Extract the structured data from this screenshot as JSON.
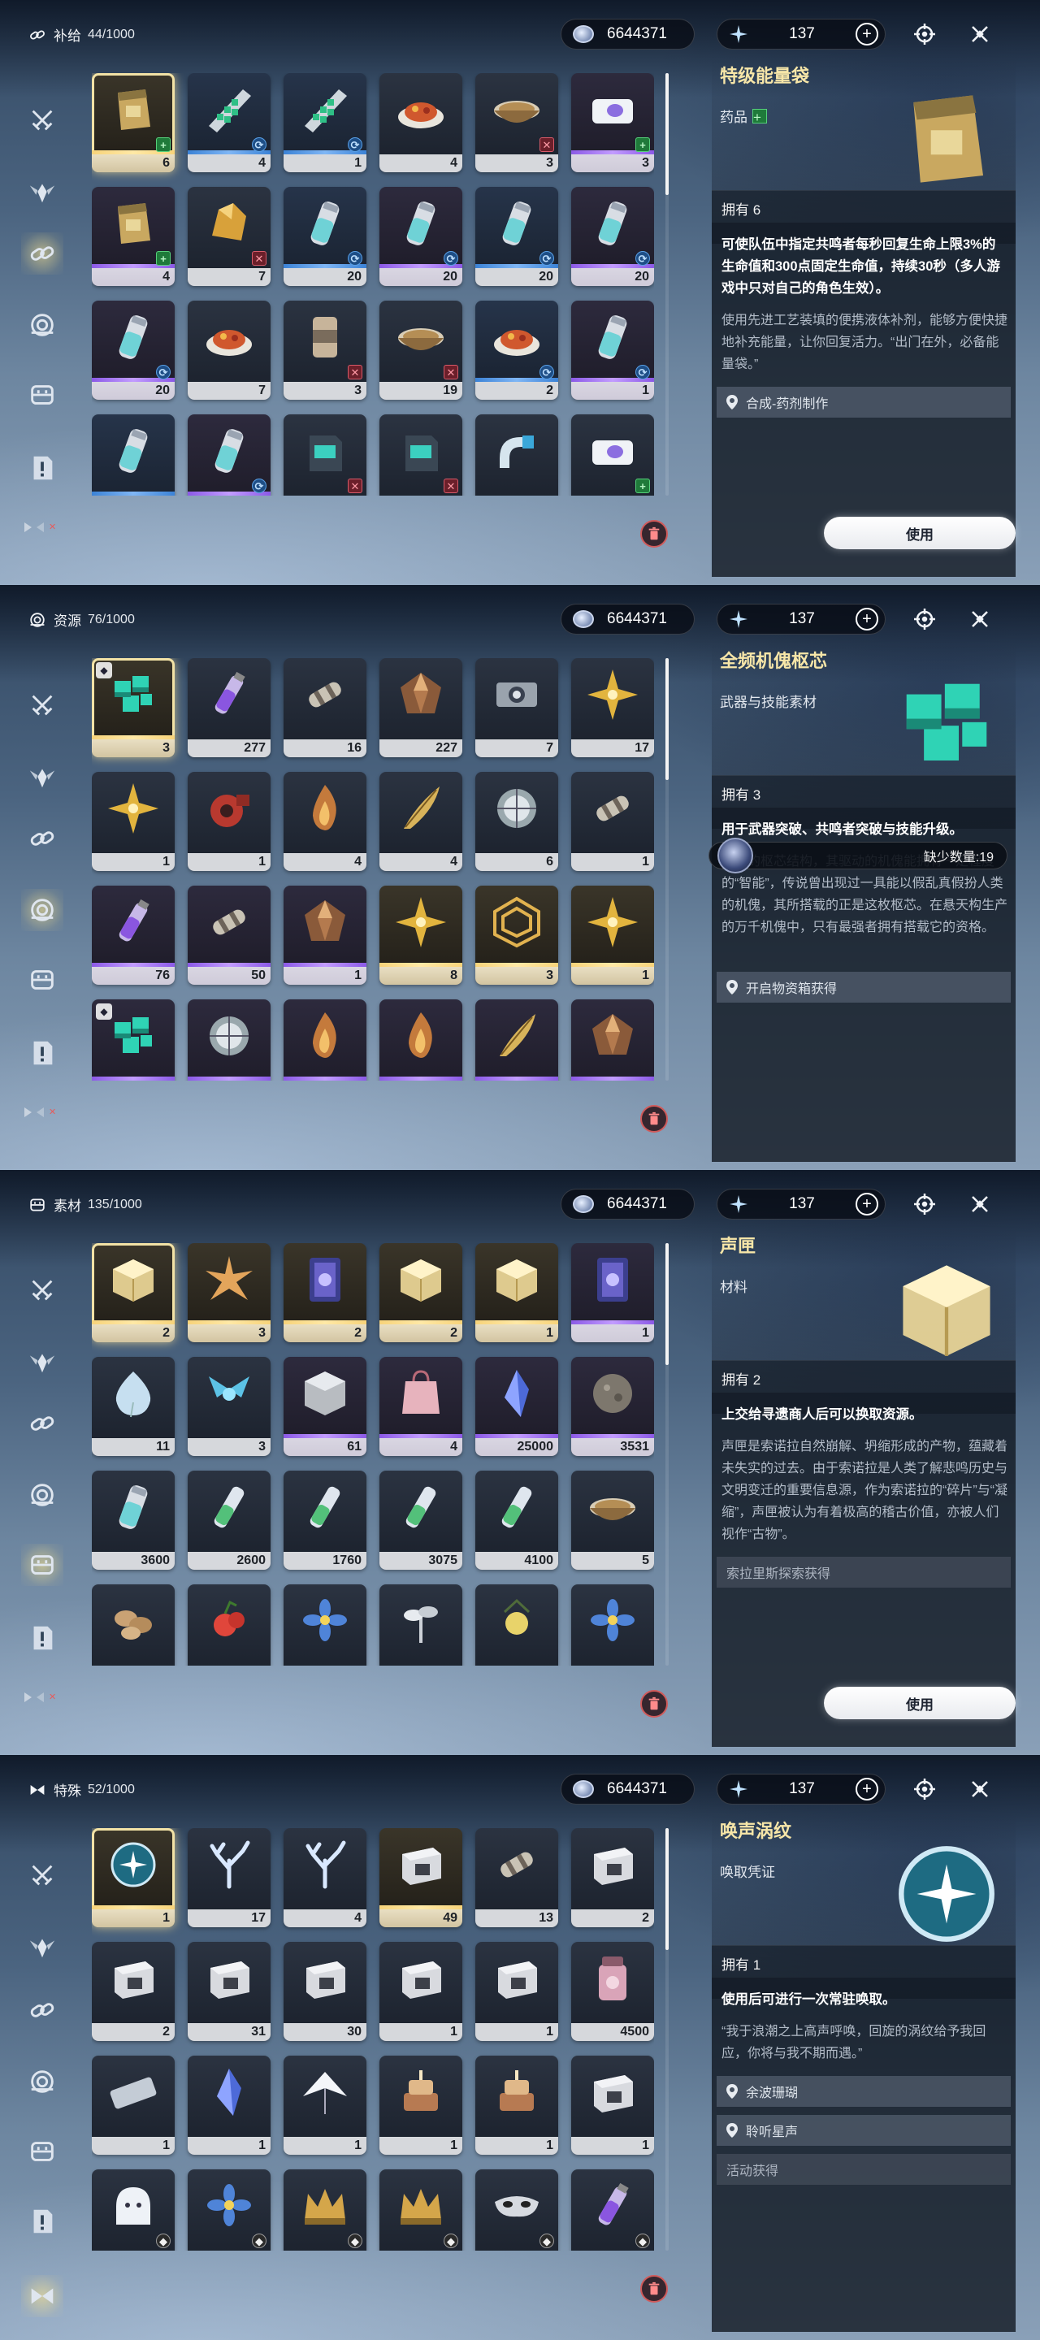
{
  "currency": {
    "shell_credit": "6644371",
    "astrite": "137"
  },
  "panels": [
    {
      "category": "补给",
      "count": "44/1000",
      "active_nav": 2,
      "selected": 0,
      "items": [
        {
          "qty": "6",
          "q": "gold",
          "badge": "plus",
          "icon": "pouch-icon"
        },
        {
          "qty": "4",
          "q": "blue",
          "badge": "swap",
          "icon": "tile-crystal-icon"
        },
        {
          "qty": "1",
          "q": "blue",
          "badge": "swap",
          "icon": "tile-crystal-icon"
        },
        {
          "qty": "4",
          "q": "gray",
          "badge": "",
          "icon": "dish-icon"
        },
        {
          "qty": "3",
          "q": "gray",
          "badge": "cross",
          "icon": "bowl-icon"
        },
        {
          "qty": "3",
          "q": "purple",
          "badge": "plus",
          "icon": "pack-icon"
        },
        {
          "qty": "4",
          "q": "purple",
          "badge": "plus",
          "icon": "pouch-icon"
        },
        {
          "qty": "7",
          "q": "gray",
          "badge": "cross",
          "icon": "ore-icon"
        },
        {
          "qty": "20",
          "q": "blue",
          "badge": "swap",
          "icon": "canister-icon"
        },
        {
          "qty": "20",
          "q": "purple",
          "badge": "swap",
          "icon": "canister-icon"
        },
        {
          "qty": "20",
          "q": "blue",
          "badge": "swap",
          "icon": "canister-icon"
        },
        {
          "qty": "20",
          "q": "purple",
          "badge": "swap",
          "icon": "canister-icon"
        },
        {
          "qty": "20",
          "q": "purple",
          "badge": "swap",
          "icon": "canister-icon"
        },
        {
          "qty": "7",
          "q": "gray",
          "badge": "",
          "icon": "dish-icon"
        },
        {
          "qty": "3",
          "q": "gray",
          "badge": "cross",
          "icon": "can-icon"
        },
        {
          "qty": "19",
          "q": "gray",
          "badge": "cross",
          "icon": "bowl-icon"
        },
        {
          "qty": "2",
          "q": "blue",
          "badge": "swap",
          "icon": "dish-icon"
        },
        {
          "qty": "1",
          "q": "purple",
          "badge": "swap",
          "icon": "canister-icon"
        },
        {
          "qty": "",
          "q": "blue",
          "badge": "",
          "icon": "canister-icon"
        },
        {
          "qty": "",
          "q": "purple",
          "badge": "swap",
          "icon": "canister-icon"
        },
        {
          "qty": "",
          "q": "gray",
          "badge": "cross",
          "icon": "jerrycan-icon"
        },
        {
          "qty": "",
          "q": "gray",
          "badge": "cross",
          "icon": "jerrycan-icon"
        },
        {
          "qty": "",
          "q": "gray",
          "badge": "",
          "icon": "tube-icon"
        },
        {
          "qty": "",
          "q": "gray",
          "badge": "plus",
          "icon": "pack-icon"
        }
      ],
      "detail": {
        "name": "特级能量袋",
        "type": "药品",
        "type_badge": "plus",
        "icon": "pouch-icon",
        "owned": "拥有 6",
        "effect": "可使队伍中指定共鸣者每秒回复生命上限3%的生命值和300点固定生命值，持续30秒（多人游戏中只对自己的角色生效）。",
        "desc": "使用先进工艺装填的便携液体补剂，能够方便快捷地补充能量，让你回复活力。“出门在外，必备能量袋。”",
        "sources": [
          {
            "text": "合成-药剂制作",
            "pin": true
          }
        ],
        "use_label": "使用",
        "lack": ""
      }
    },
    {
      "category": "资源",
      "count": "76/1000",
      "active_nav": 3,
      "selected": 0,
      "items": [
        {
          "qty": "3",
          "q": "gold",
          "badge": "",
          "icon": "cube-icon",
          "mark": true
        },
        {
          "qty": "277",
          "q": "gray",
          "badge": "",
          "icon": "bottle-icon"
        },
        {
          "qty": "16",
          "q": "gray",
          "badge": "",
          "icon": "cylinder-icon"
        },
        {
          "qty": "227",
          "q": "gray",
          "badge": "",
          "icon": "gem-icon"
        },
        {
          "qty": "7",
          "q": "gray",
          "badge": "",
          "icon": "device-icon"
        },
        {
          "qty": "17",
          "q": "gray",
          "badge": "",
          "icon": "star-icon"
        },
        {
          "qty": "1",
          "q": "gray",
          "badge": "",
          "icon": "star-icon"
        },
        {
          "qty": "1",
          "q": "gray",
          "badge": "",
          "icon": "mech-icon"
        },
        {
          "qty": "4",
          "q": "gray",
          "badge": "",
          "icon": "flame-icon"
        },
        {
          "qty": "4",
          "q": "gray",
          "badge": "",
          "icon": "feather-icon"
        },
        {
          "qty": "6",
          "q": "gray",
          "badge": "",
          "icon": "shell-icon"
        },
        {
          "qty": "1",
          "q": "gray",
          "badge": "",
          "icon": "cylinder-icon"
        },
        {
          "qty": "76",
          "q": "purple",
          "badge": "",
          "icon": "bottle-icon"
        },
        {
          "qty": "50",
          "q": "purple",
          "badge": "",
          "icon": "cylinder-icon"
        },
        {
          "qty": "1",
          "q": "purple",
          "badge": "",
          "icon": "gem-icon"
        },
        {
          "qty": "8",
          "q": "gold",
          "badge": "",
          "icon": "star-icon"
        },
        {
          "qty": "3",
          "q": "gold",
          "badge": "",
          "icon": "rings-icon"
        },
        {
          "qty": "1",
          "q": "gold",
          "badge": "",
          "icon": "star-icon"
        },
        {
          "qty": "",
          "q": "purple",
          "badge": "",
          "icon": "cube-icon",
          "mark": true
        },
        {
          "qty": "",
          "q": "purple",
          "badge": "",
          "icon": "shell-icon"
        },
        {
          "qty": "",
          "q": "purple",
          "badge": "",
          "icon": "flame-icon"
        },
        {
          "qty": "",
          "q": "purple",
          "badge": "",
          "icon": "flame-icon"
        },
        {
          "qty": "",
          "q": "purple",
          "badge": "",
          "icon": "feather-icon"
        },
        {
          "qty": "",
          "q": "purple",
          "badge": "",
          "icon": "gem-icon"
        }
      ],
      "detail": {
        "name": "全频机傀枢芯",
        "type": "武器与技能素材",
        "type_badge": "",
        "icon": "cube-icon",
        "owned": "拥有 3",
        "effect": "用于武器突破、共鸣者突破与技能升级。",
        "desc": "特殊的枢芯结构，其驱动的机傀能拥有一定程度的“智能”，传说曾出现过一具能以假乱真假扮人类的机傀，其所搭载的正是这枚枢芯。在悬天构生产的万千机傀中，只有最强者拥有搭载它的资格。",
        "sources": [
          {
            "text": "开启物资箱获得",
            "pin": true
          }
        ],
        "use_label": "",
        "lack": "缺少数量:19"
      }
    },
    {
      "category": "素材",
      "count": "135/1000",
      "active_nav": 4,
      "selected": 0,
      "items": [
        {
          "qty": "2",
          "q": "gold",
          "badge": "",
          "icon": "box-icon"
        },
        {
          "qty": "3",
          "q": "gold",
          "badge": "",
          "icon": "burst-icon"
        },
        {
          "qty": "2",
          "q": "gold",
          "badge": "",
          "icon": "card-icon"
        },
        {
          "qty": "2",
          "q": "gold",
          "badge": "",
          "icon": "box-icon"
        },
        {
          "qty": "1",
          "q": "gold",
          "badge": "",
          "icon": "box-icon"
        },
        {
          "qty": "1",
          "q": "purple",
          "badge": "",
          "icon": "card-icon"
        },
        {
          "qty": "11",
          "q": "gray",
          "badge": "",
          "icon": "drop-icon"
        },
        {
          "qty": "3",
          "q": "gray",
          "badge": "",
          "icon": "wing-icon"
        },
        {
          "qty": "61",
          "q": "purple",
          "badge": "",
          "icon": "block-icon"
        },
        {
          "qty": "4",
          "q": "purple",
          "badge": "",
          "icon": "bag-icon"
        },
        {
          "qty": "25000",
          "q": "purple",
          "badge": "",
          "icon": "shard-icon"
        },
        {
          "qty": "3531",
          "q": "purple",
          "badge": "",
          "icon": "rock-icon"
        },
        {
          "qty": "3600",
          "q": "gray",
          "badge": "",
          "icon": "canister-icon"
        },
        {
          "qty": "2600",
          "q": "gray",
          "badge": "",
          "icon": "vial-icon"
        },
        {
          "qty": "1760",
          "q": "gray",
          "badge": "",
          "icon": "vial-icon"
        },
        {
          "qty": "3075",
          "q": "gray",
          "badge": "",
          "icon": "vial-icon"
        },
        {
          "qty": "4100",
          "q": "gray",
          "badge": "",
          "icon": "vial-icon"
        },
        {
          "qty": "5",
          "q": "gray",
          "badge": "",
          "icon": "bowl-icon"
        },
        {
          "qty": "",
          "q": "gray",
          "badge": "",
          "icon": "nuts-icon"
        },
        {
          "qty": "",
          "q": "gray",
          "badge": "",
          "icon": "berry-icon"
        },
        {
          "qty": "",
          "q": "gray",
          "badge": "",
          "icon": "flower-icon"
        },
        {
          "qty": "",
          "q": "gray",
          "badge": "",
          "icon": "sprout-icon"
        },
        {
          "qty": "",
          "q": "gray",
          "badge": "",
          "icon": "bulb-icon"
        },
        {
          "qty": "",
          "q": "gray",
          "badge": "",
          "icon": "flower-icon"
        }
      ],
      "detail": {
        "name": "声匣",
        "type": "材料",
        "type_badge": "",
        "icon": "box-icon",
        "owned": "拥有 2",
        "effect": "上交给寻遗商人后可以换取资源。",
        "desc": "声匣是索诺拉自然崩解、坍缩形成的产物，蕴藏着未失实的过去。由于索诺拉是人类了解悲鸣历史与文明变迁的重要信息源，作为索诺拉的“碎片”与“凝缩”，声匣被认为有着极高的稽古价值，亦被人们视作“古物”。",
        "sources": [
          {
            "text": "索拉里斯探索获得",
            "pin": false
          }
        ],
        "use_label": "使用",
        "lack": ""
      }
    },
    {
      "category": "特殊",
      "count": "52/1000",
      "active_nav": 6,
      "selected": 0,
      "items": [
        {
          "qty": "1",
          "q": "gold",
          "badge": "",
          "icon": "orb-icon"
        },
        {
          "qty": "17",
          "q": "gray",
          "badge": "",
          "icon": "coral-icon"
        },
        {
          "qty": "4",
          "q": "gray",
          "badge": "",
          "icon": "coral-icon"
        },
        {
          "qty": "49",
          "q": "gold",
          "badge": "",
          "icon": "crate-icon"
        },
        {
          "qty": "13",
          "q": "gray",
          "badge": "",
          "icon": "cylinder-icon"
        },
        {
          "qty": "2",
          "q": "gray",
          "badge": "",
          "icon": "crate-icon"
        },
        {
          "qty": "2",
          "q": "gray",
          "badge": "",
          "icon": "crate-icon"
        },
        {
          "qty": "31",
          "q": "gray",
          "badge": "",
          "icon": "crate-icon"
        },
        {
          "qty": "30",
          "q": "gray",
          "badge": "",
          "icon": "crate-icon"
        },
        {
          "qty": "1",
          "q": "gray",
          "badge": "",
          "icon": "crate-icon"
        },
        {
          "qty": "1",
          "q": "gray",
          "badge": "",
          "icon": "crate-icon"
        },
        {
          "qty": "4500",
          "q": "gray",
          "badge": "",
          "icon": "jar-icon"
        },
        {
          "qty": "1",
          "q": "gray",
          "badge": "",
          "icon": "ticket-icon"
        },
        {
          "qty": "1",
          "q": "gray",
          "badge": "",
          "icon": "shard-icon"
        },
        {
          "qty": "1",
          "q": "gray",
          "badge": "",
          "icon": "crane-icon"
        },
        {
          "qty": "1",
          "q": "gray",
          "badge": "",
          "icon": "cake-icon"
        },
        {
          "qty": "1",
          "q": "gray",
          "badge": "",
          "icon": "cake-icon"
        },
        {
          "qty": "1",
          "q": "gray",
          "badge": "",
          "icon": "crate-icon"
        },
        {
          "qty": "",
          "q": "gray",
          "badge": "drop",
          "icon": "ghost-icon"
        },
        {
          "qty": "",
          "q": "gray",
          "badge": "drop",
          "icon": "flower-icon"
        },
        {
          "qty": "",
          "q": "gray",
          "badge": "drop",
          "icon": "crown-icon"
        },
        {
          "qty": "",
          "q": "gray",
          "badge": "drop",
          "icon": "crown-icon"
        },
        {
          "qty": "",
          "q": "gray",
          "badge": "drop",
          "icon": "mask-icon"
        },
        {
          "qty": "",
          "q": "gray",
          "badge": "drop",
          "icon": "bottle-icon"
        }
      ],
      "detail": {
        "name": "唤声涡纹",
        "type": "唤取凭证",
        "type_badge": "",
        "icon": "orb-icon",
        "owned": "拥有 1",
        "effect": "使用后可进行一次常驻唤取。",
        "desc": "“我于浪潮之上高声呼唤，回旋的涡纹给予我回应，你将与我不期而遇。”",
        "sources": [
          {
            "text": "余波珊瑚",
            "pin": true
          },
          {
            "text": "聆听星声",
            "pin": true
          },
          {
            "text": "活动获得",
            "pin": false
          }
        ],
        "use_label": "",
        "lack": ""
      }
    }
  ],
  "colors": {
    "gold_name": "#f7e6a8",
    "rarity_gold": "#f7d37a",
    "rarity_purple": "#a87cf0",
    "rarity_blue": "#5fa2ee",
    "delete_red": "#d05a5a"
  },
  "nav_icons": [
    "swords-icon",
    "winged-helm-icon",
    "chain-link-icon",
    "ring-target-icon",
    "supply-box-icon",
    "scroll-icon",
    "special-icon"
  ]
}
